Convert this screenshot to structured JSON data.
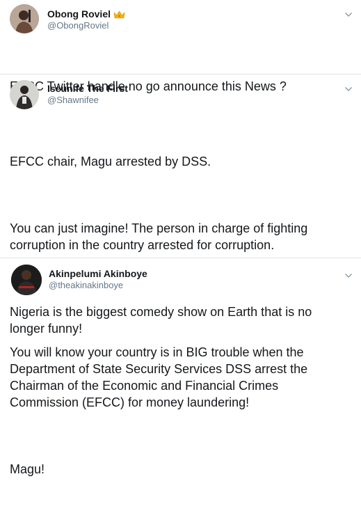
{
  "tweets": [
    {
      "display_name": "Obong Roviel",
      "handle": "@ObongRoviel",
      "paragraphs": [
        "EFCC Twitter handle no go announce this News ?"
      ]
    },
    {
      "display_name": "Iseunife The First",
      "handle": "@Shawnifee",
      "paragraphs": [
        "EFCC chair, Magu arrested by DSS.",
        "You can just imagine! The person in charge of fighting\ncorruption in the country arrested for corruption.",
        "Nigeria is the biggest comedy show on Earth that is no\nlonger funny!"
      ]
    },
    {
      "display_name": "Akinpelumi Akinboye",
      "handle": "@theakinakinboye",
      "paragraphs": [
        "You will know your country is in BIG trouble when the\nDepartment of State Security Services DSS arrest the\nChairman of the Economic and Financial Crimes\nCommission (EFCC) for money laundering!",
        "Magu!"
      ]
    }
  ],
  "icons": {
    "menu": "chevron-down-icon",
    "badge": "crown-emoji-icon"
  },
  "colors": {
    "text": "#14171a",
    "secondary": "#657786",
    "divider": "#dfe3e6",
    "crown": "#f5b400"
  }
}
